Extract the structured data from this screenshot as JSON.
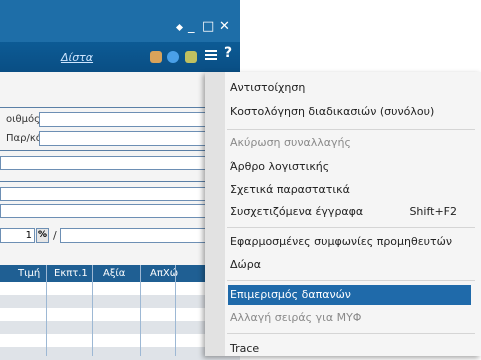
{
  "toolbar": {
    "button_label": "Δίστα"
  },
  "window_controls": {
    "minimize": "_",
    "maximize": "□",
    "close": "✕"
  },
  "form": {
    "label1": "οιθμός",
    "label2": "Παρ/κό",
    "qty_value": "1",
    "percent_symbol": "%"
  },
  "table": {
    "headers": [
      "Τιμή",
      "Εκπτ.1",
      "Αξία",
      "ΑπΧώ"
    ]
  },
  "menu": {
    "items": [
      {
        "label": "Αντιστοίχηση",
        "disabled": false
      },
      {
        "label": "Κοστολόγηση διαδικασιών (συνόλου)",
        "disabled": false
      },
      {
        "label": "Ακύρωση συναλλαγής",
        "disabled": true
      },
      {
        "label": "Άρθρο λογιστικής",
        "disabled": false
      },
      {
        "label": "Σχετικά παραστατικά",
        "disabled": false
      },
      {
        "label": "Συσχετιζόμενα έγγραφα",
        "shortcut": "Shift+F2",
        "disabled": false
      },
      {
        "label": "Εφαρμοσμένες συμφωνίες προμηθευτών",
        "disabled": false
      },
      {
        "label": "Δώρα",
        "disabled": false
      },
      {
        "label": "Επιμερισμός δαπανών",
        "selected": true
      },
      {
        "label": "Αλλαγή σειράς για ΜΥΦ",
        "disabled": true
      },
      {
        "label": "Trace",
        "disabled": false
      }
    ]
  },
  "colors": {
    "accent": "#1f6aaa",
    "titlebar": "#1e6ea8"
  }
}
